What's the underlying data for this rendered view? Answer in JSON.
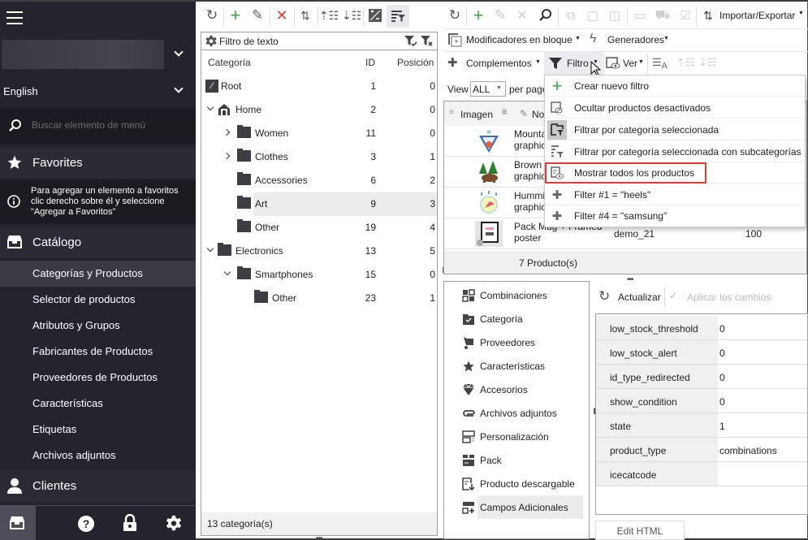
{
  "sidebar": {
    "language": "English",
    "search_placeholder": "Buscar elemento de menú",
    "favorites_label": "Favorites",
    "favorites_info": "Para agregar un elemento a favoritos clic derecho sobre él y seleccione \"Agregar a Favoritos\"",
    "catalog_label": "Catálogo",
    "catalog_items": [
      {
        "label": "Categorías y Productos",
        "active": true
      },
      {
        "label": "Selector de productos"
      },
      {
        "label": "Atributos y Grupos"
      },
      {
        "label": "Fabricantes de Productos"
      },
      {
        "label": "Proveedores de Productos"
      },
      {
        "label": "Características"
      },
      {
        "label": "Etiquetas"
      },
      {
        "label": "Archivos adjuntos"
      }
    ],
    "clients_label": "Clientes",
    "footer_icons": [
      "catalog-icon",
      "help-icon",
      "lock-icon",
      "settings-icon"
    ]
  },
  "category_panel": {
    "toolbar_icons": [
      "refresh-icon",
      "add-icon",
      "edit-icon",
      "delete-icon",
      "sort-icon",
      "move-up-icon",
      "move-down-icon",
      "expand-collapse-icon",
      "filter-list-icon"
    ],
    "filter_label": "Filtro de texto",
    "columns": {
      "name": "Categoría",
      "id": "ID",
      "position": "Posición"
    },
    "rows": [
      {
        "name": "Root",
        "id": "1",
        "position": "0",
        "level": 0,
        "icon": "root"
      },
      {
        "name": "Home",
        "id": "2",
        "position": "0",
        "level": 0,
        "icon": "home",
        "expanded": true
      },
      {
        "name": "Women",
        "id": "11",
        "position": "0",
        "level": 1,
        "collapsed": true
      },
      {
        "name": "Clothes",
        "id": "3",
        "position": "1",
        "level": 1,
        "collapsed": true
      },
      {
        "name": "Accessories",
        "id": "6",
        "position": "2",
        "level": 1
      },
      {
        "name": "Art",
        "id": "9",
        "position": "3",
        "level": 1,
        "selected": true
      },
      {
        "name": "Other",
        "id": "19",
        "position": "4",
        "level": 1
      },
      {
        "name": "Electronics",
        "id": "13",
        "position": "5",
        "level": 0,
        "expanded": true
      },
      {
        "name": "Smartphones",
        "id": "15",
        "position": "0",
        "level": 1,
        "expanded": true
      },
      {
        "name": "Other",
        "id": "23",
        "position": "1",
        "level": 2
      }
    ],
    "footer": "13 categoría(s)"
  },
  "product_panel": {
    "import_export": "Importar/Exportar",
    "bulk_modifiers": "Modificadores en bloque",
    "generators": "Generadores",
    "addons": "Complementos",
    "filter": "Filtro",
    "view": "Ver",
    "view_label": "View",
    "view_value": "ALL",
    "per_page": "per page",
    "col_image": "Imagen",
    "col_name": "No",
    "products": [
      {
        "name": "Mountain fox graphics",
        "visible_name": "Mounta\ngraphic"
      },
      {
        "name": "Brown bear graphics",
        "visible_name": "Brown\ngraphic"
      },
      {
        "name": "Hummingbird graphics",
        "visible_name": "Hummi\ngraphic"
      },
      {
        "name": "Pack Mug + Framed poster",
        "visible_name": "Pack Mug + Framed\nposter",
        "reference": "demo_21",
        "qty": "100"
      }
    ],
    "count": "7 Producto(s)"
  },
  "filter_menu": {
    "items": [
      {
        "label": "Crear nuevo filtro",
        "icon": "plus-icon"
      },
      {
        "label": "Ocultar productos desactivados",
        "icon": "hide-disabled-icon"
      },
      {
        "label": "Filtrar por categoría seleccionada",
        "icon": "folder-filter-icon"
      },
      {
        "label": "Filtrar por categoría seleccionada con subcategorías",
        "icon": "subcategory-filter-icon"
      },
      {
        "label": "Mostrar todos los productos",
        "icon": "show-all-icon",
        "highlighted": true
      },
      {
        "label": "Filter #1 = \"heels\"",
        "icon": "saved-filter-icon"
      },
      {
        "label": "Filter #4 = \"samsung\"",
        "icon": "saved-filter-icon"
      }
    ],
    "highlight_color": "#e53935"
  },
  "detail_tabs": [
    {
      "label": "Combinaciones"
    },
    {
      "label": "Categoría"
    },
    {
      "label": "Proveedores"
    },
    {
      "label": "Características"
    },
    {
      "label": "Accesorios"
    },
    {
      "label": "Archivos adjuntos"
    },
    {
      "label": "Personalización"
    },
    {
      "label": "Pack"
    },
    {
      "label": "Producto descargable"
    },
    {
      "label": "Campos Adicionales",
      "active": true
    }
  ],
  "properties": {
    "refresh": "Actualizar",
    "apply": "Aplicar los cambios",
    "rows": [
      {
        "key": "low_stock_threshold",
        "value": "0"
      },
      {
        "key": "low_stock_alert",
        "value": "0"
      },
      {
        "key": "id_type_redirected",
        "value": "0"
      },
      {
        "key": "show_condition",
        "value": "0"
      },
      {
        "key": "state",
        "value": "1"
      },
      {
        "key": "product_type",
        "value": "combinations"
      },
      {
        "key": "icecatcode",
        "value": ""
      }
    ],
    "edit_html": "Edit HTML"
  }
}
